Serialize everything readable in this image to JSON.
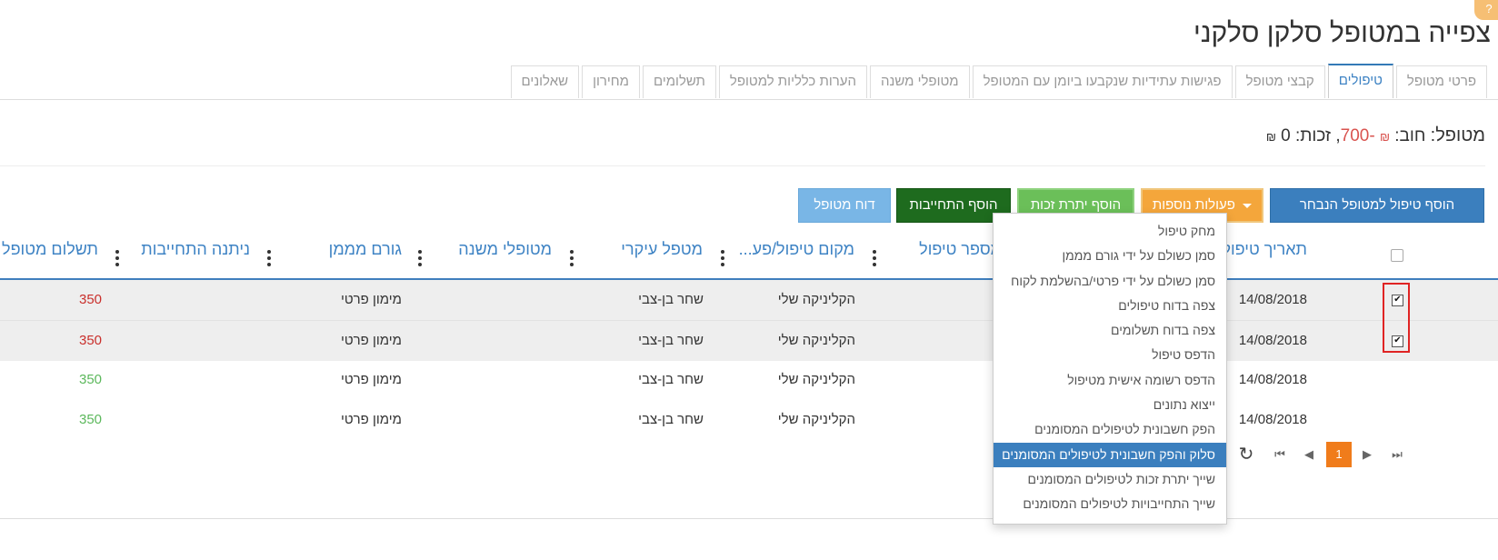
{
  "page": {
    "title": "צפייה במטופל סלקן סלקני",
    "corner_badge": "?"
  },
  "tabs": [
    {
      "label": "פרטי מטופל"
    },
    {
      "label": "טיפולים",
      "active": true
    },
    {
      "label": "קבצי מטופל"
    },
    {
      "label": "פגישות עתידיות שנקבעו ביומן עם המטופל"
    },
    {
      "label": "מטופלי משנה"
    },
    {
      "label": "הערות כלליות למטופל"
    },
    {
      "label": "תשלומים"
    },
    {
      "label": "מחירון"
    },
    {
      "label": "שאלונים"
    }
  ],
  "balance": {
    "patient_label": "מטופל:",
    "debt_label": "חוב:",
    "debt_value": "-700",
    "currency": "₪",
    "separator": ", ",
    "credit_label": "זכות:",
    "credit_value": "0"
  },
  "toolbar": {
    "add_treatment": "הוסף טיפול למטופל הנבחר",
    "more_actions": "פעולות נוספות",
    "add_credit": "הוסף יתרת זכות",
    "add_obligation": "הוסף התחייבות",
    "patient_report": "דוח מטופל"
  },
  "table": {
    "columns": {
      "date": "תאריך טיפול",
      "number": "מספר טיפול",
      "location": "מקום טיפול/פע...",
      "therapist": "מטפל עיקרי",
      "sub_patients": "מטופלי משנה",
      "funder": "גורם מממן",
      "obligation": "ניתנה התחייבות",
      "payment": "תשלום מטופל"
    },
    "rows": [
      {
        "date": "14/08/2018",
        "location": "הקליניקה שלי",
        "therapist": "שחר בן-צבי",
        "funder": "מימון פרטי",
        "payment": "350",
        "payment_color": "red",
        "checked": true
      },
      {
        "date": "14/08/2018",
        "location": "הקליניקה שלי",
        "therapist": "שחר בן-צבי",
        "funder": "מימון פרטי",
        "payment": "350",
        "payment_color": "red",
        "checked": true
      },
      {
        "date": "14/08/2018",
        "location": "הקליניקה שלי",
        "therapist": "שחר בן-צבי",
        "funder": "מימון פרטי",
        "payment": "350",
        "payment_color": "green",
        "checked": false
      },
      {
        "date": "14/08/2018",
        "location": "הקליניקה שלי",
        "therapist": "שחר בן-צבי",
        "funder": "מימון פרטי",
        "payment": "350",
        "payment_color": "green",
        "checked": false
      }
    ],
    "check_mark": "✔"
  },
  "pager": {
    "current_page": "1",
    "first": "⏮",
    "prev": "◀",
    "next": "▶",
    "last": "⏭",
    "refresh": "↻"
  },
  "dropdown": {
    "items": [
      "מחק טיפול",
      "סמן כשולם על ידי גורם מממן",
      "סמן כשולם על ידי פרטי/בהשלמת לקוח",
      "צפה בדוח טיפולים",
      "צפה בדוח תשלומים",
      "הדפס טיפול",
      "הדפס רשומה אישית מטיפול",
      "ייצוא נתונים",
      "הפק חשבונית לטיפולים המסומנים",
      "סלוק והפק חשבונית לטיפולים המסומנים",
      "שייך יתרת זכות לטיפולים המסומנים",
      "שייך התחייבויות לטיפולים המסומנים"
    ],
    "hover_index": 9
  },
  "colors": {
    "primary": "#3b7fbe",
    "warning": "#f4a63b",
    "success": "#6bbf59",
    "dark_success": "#1e6b1e",
    "info": "#79b6e6",
    "danger": "#c9302c",
    "pager_active": "#f07c1b"
  }
}
